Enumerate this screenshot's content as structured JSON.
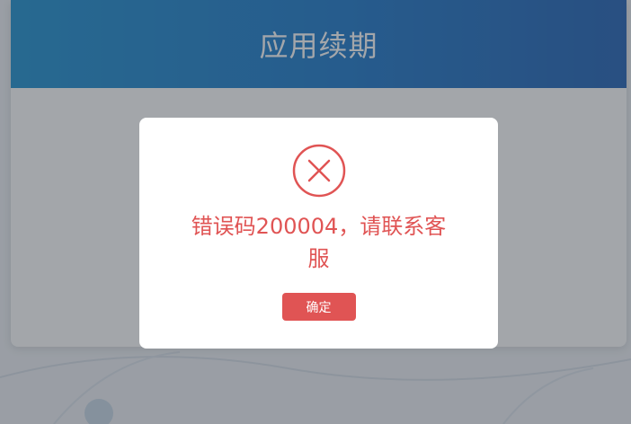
{
  "header": {
    "title": "应用续期"
  },
  "dialog": {
    "icon": "error-circle-x-icon",
    "message": "错误码200004，请联系客服",
    "confirm_label": "确定"
  },
  "colors": {
    "header_gradient_start": "#1b8fd0",
    "header_gradient_end": "#1e5fb4",
    "error": "#e05454",
    "mask": "rgba(55,60,70,0.46)"
  }
}
